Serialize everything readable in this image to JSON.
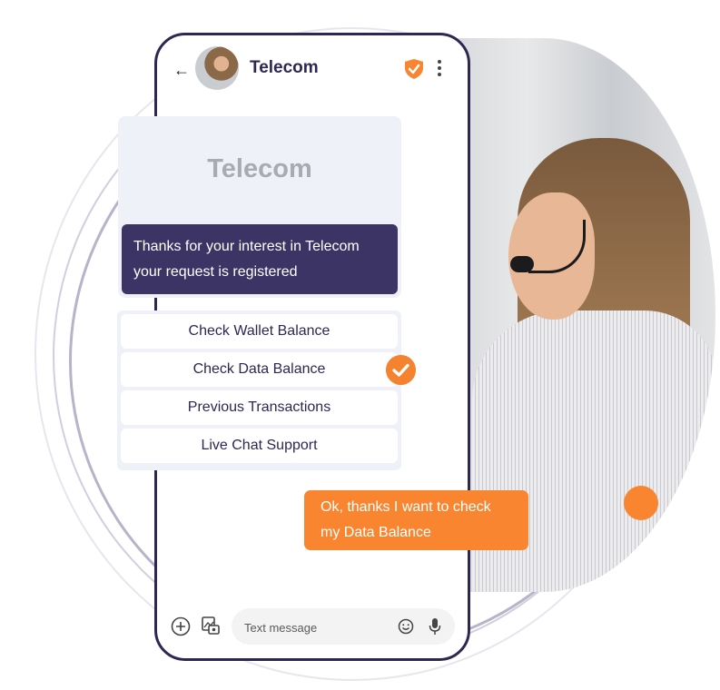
{
  "colors": {
    "brand_dark": "#2e2753",
    "bot_bubble": "#3c3465",
    "accent_orange": "#f98531",
    "card_bg": "#eef1f7"
  },
  "header": {
    "back_icon": "arrow-left-icon",
    "contact_name": "Telecom",
    "verified_icon": "shield-check-icon",
    "menu_icon": "more-vertical-icon"
  },
  "card": {
    "brand_text": "Telecom",
    "bot_message": "Thanks for your interest in Telecom your request is registered"
  },
  "options": [
    {
      "label": "Check Wallet Balance",
      "selected": false
    },
    {
      "label": "Check Data Balance",
      "selected": true
    },
    {
      "label": "Previous Transactions",
      "selected": false
    },
    {
      "label": "Live Chat Support",
      "selected": false
    }
  ],
  "user_message": "Ok, thanks I want to check my Data Balance",
  "composer": {
    "placeholder": "Text message",
    "value": "",
    "icons": [
      "add-circle-icon",
      "gallery-icon",
      "emoji-icon",
      "microphone-icon"
    ]
  }
}
